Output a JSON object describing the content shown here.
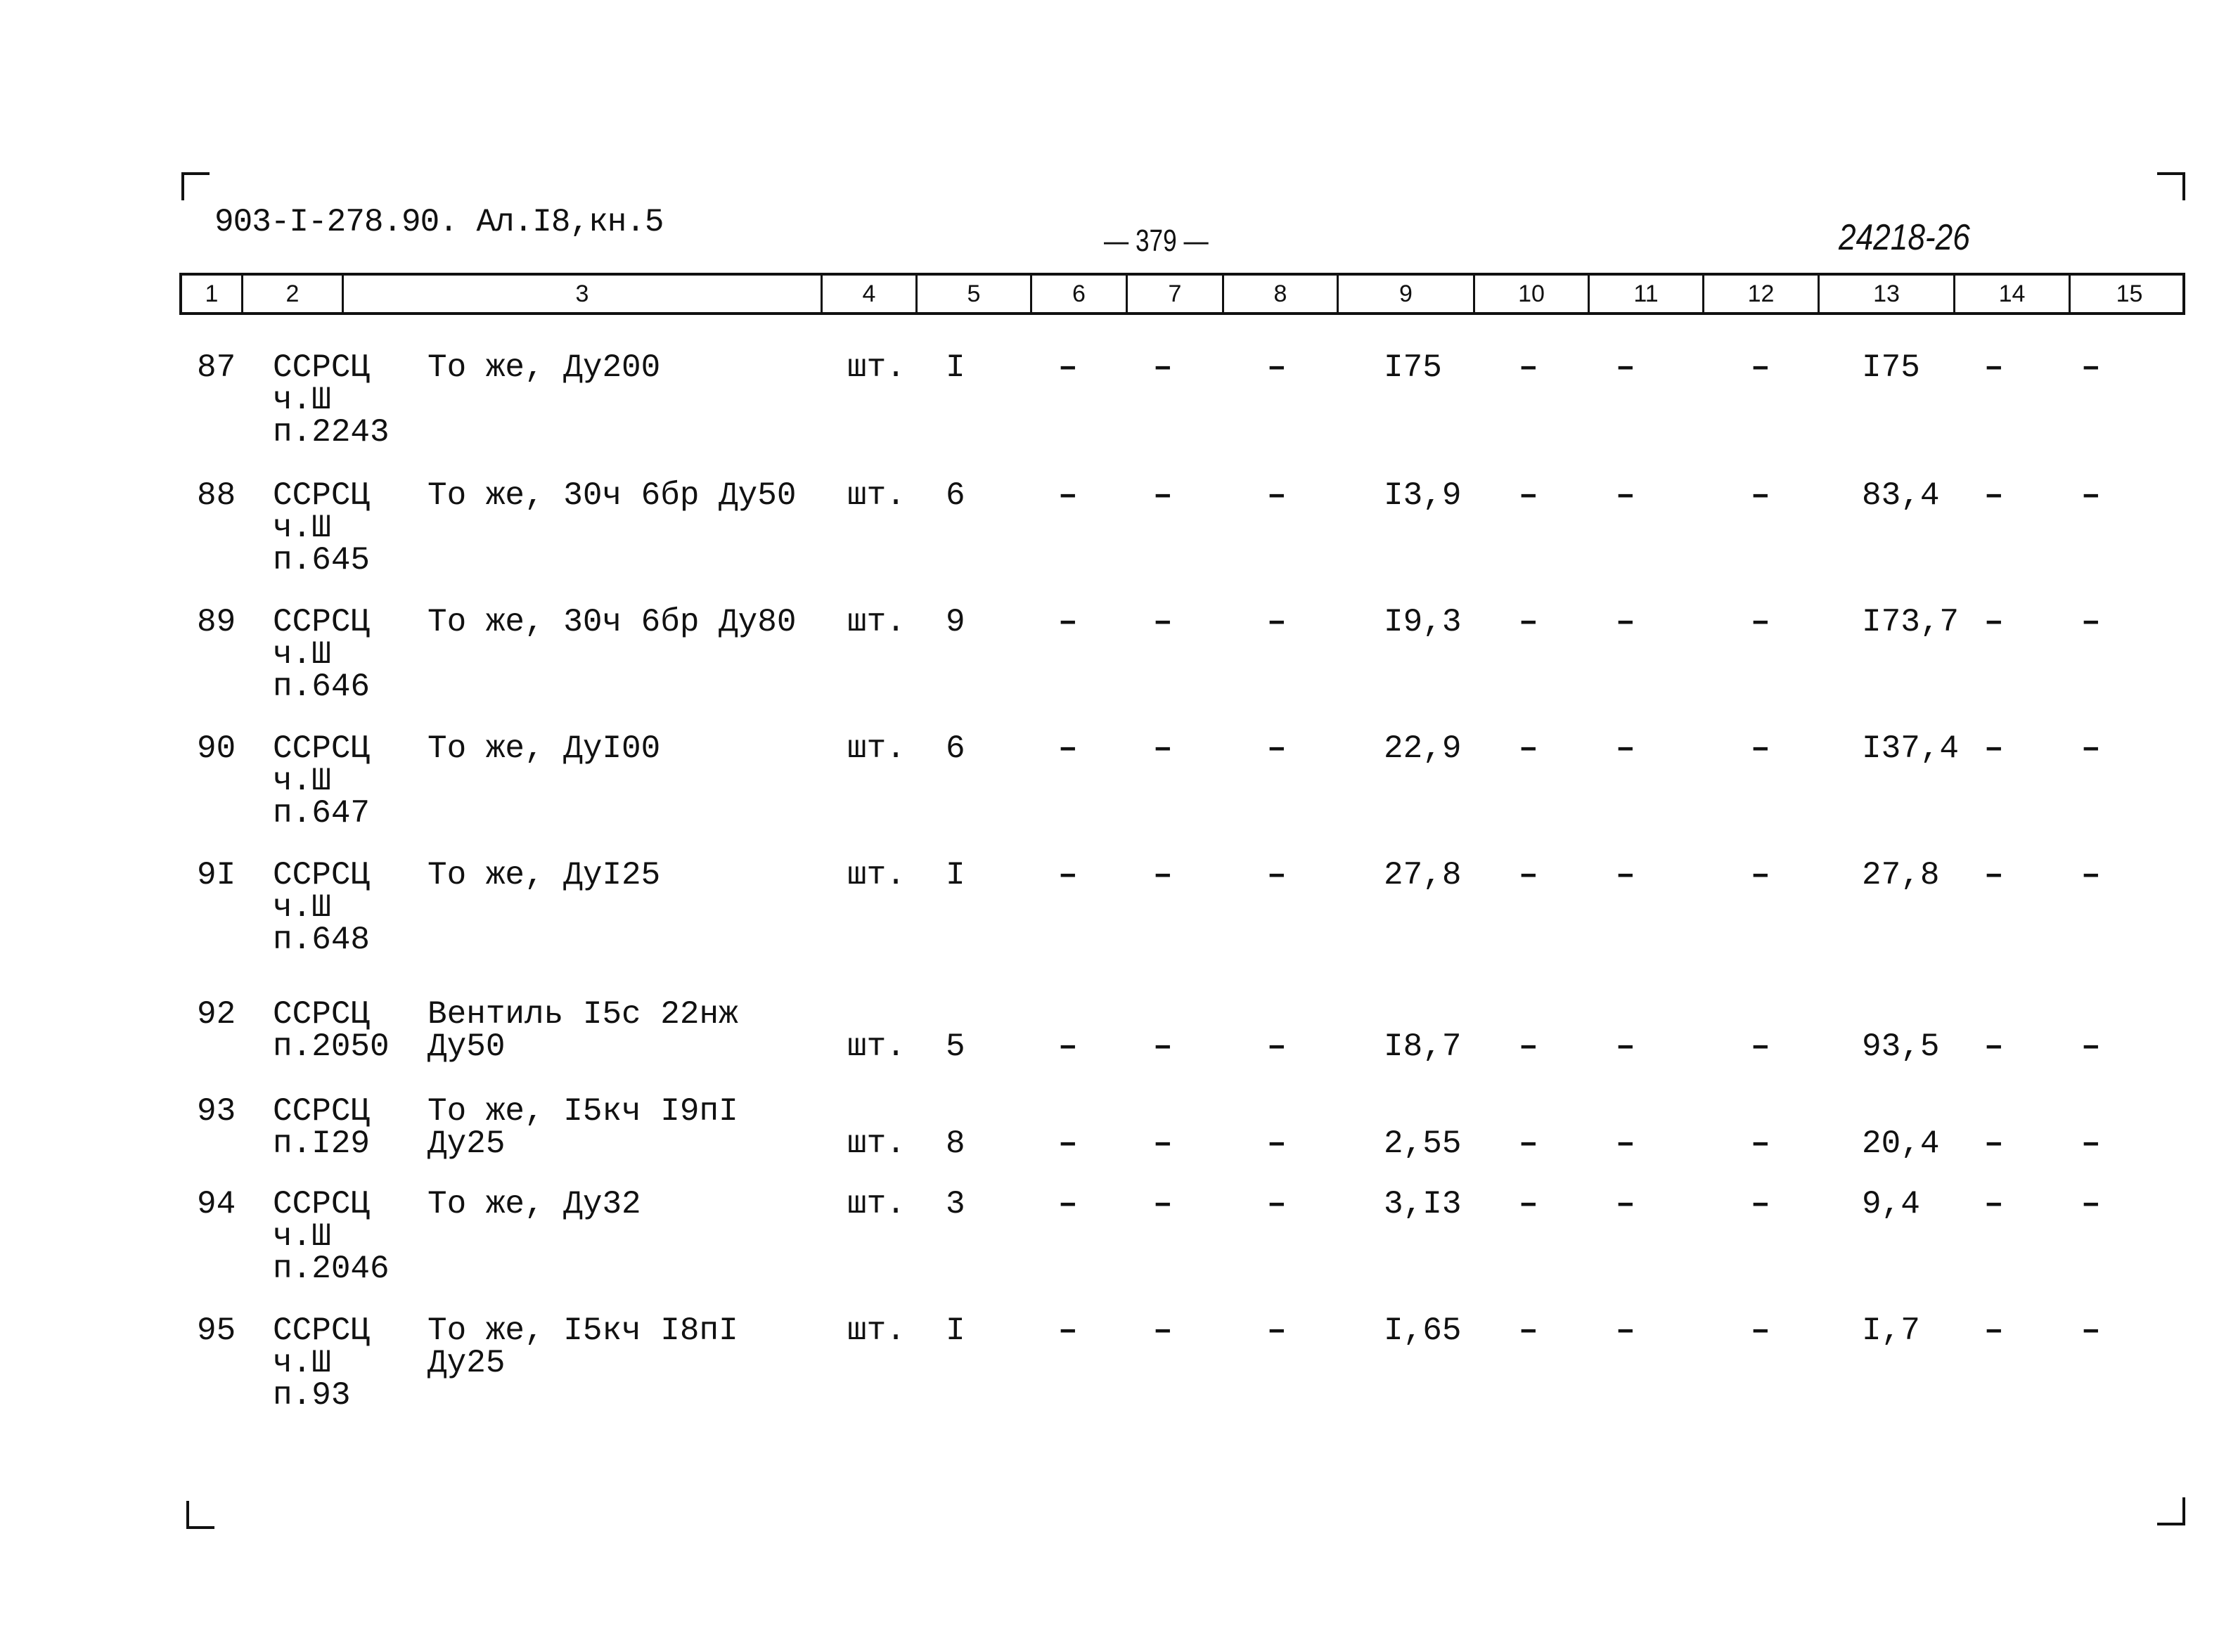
{
  "header": {
    "doc_code": "903-I-278.90. Ал.I8,кн.5",
    "page_number": "— 379 —",
    "archive_number": "24218-26"
  },
  "columns": [
    "1",
    "2",
    "3",
    "4",
    "5",
    "6",
    "7",
    "8",
    "9",
    "10",
    "11",
    "12",
    "13",
    "14",
    "15"
  ],
  "rows": [
    {
      "n": "87",
      "ref": [
        "ССРСЦ",
        "ч.Ш",
        "п.2243"
      ],
      "desc": [
        "То же, Ду200"
      ],
      "unit": "шт.",
      "qty": "I",
      "c6": "–",
      "c7": "–",
      "c8": "–",
      "c9": "I75",
      "c10": "–",
      "c11": "–",
      "c12": "–",
      "c13": "I75",
      "c14": "–",
      "c15": "–"
    },
    {
      "n": "88",
      "ref": [
        "ССРСЦ",
        "ч.Ш",
        "п.645"
      ],
      "desc": [
        "То же, 30ч 6бр Ду50"
      ],
      "unit": "шт.",
      "qty": "6",
      "c6": "–",
      "c7": "–",
      "c8": "–",
      "c9": "I3,9",
      "c10": "–",
      "c11": "–",
      "c12": "–",
      "c13": "83,4",
      "c14": "–",
      "c15": "–"
    },
    {
      "n": "89",
      "ref": [
        "ССРСЦ",
        "ч.Ш",
        "п.646"
      ],
      "desc": [
        "То же, 30ч 6бр Ду80"
      ],
      "unit": "шт.",
      "qty": "9",
      "c6": "–",
      "c7": "–",
      "c8": "–",
      "c9": "I9,3",
      "c10": "–",
      "c11": "–",
      "c12": "–",
      "c13": "I73,7",
      "c14": "–",
      "c15": "–"
    },
    {
      "n": "90",
      "ref": [
        "ССРСЦ",
        "ч.Ш",
        "п.647"
      ],
      "desc": [
        "То же, ДуI00"
      ],
      "unit": "шт.",
      "qty": "6",
      "c6": "–",
      "c7": "–",
      "c8": "–",
      "c9": "22,9",
      "c10": "–",
      "c11": "–",
      "c12": "–",
      "c13": "I37,4",
      "c14": "–",
      "c15": "–"
    },
    {
      "n": "9I",
      "ref": [
        "ССРСЦ",
        "ч.Ш",
        "п.648"
      ],
      "desc": [
        "То же, ДуI25"
      ],
      "unit": "шт.",
      "qty": "I",
      "c6": "–",
      "c7": "–",
      "c8": "–",
      "c9": "27,8",
      "c10": "–",
      "c11": "–",
      "c12": "–",
      "c13": "27,8",
      "c14": "–",
      "c15": "–"
    },
    {
      "n": "92",
      "ref": [
        "ССРСЦ",
        "п.2050"
      ],
      "desc": [
        "Вентиль I5с 22нж",
        "Ду50"
      ],
      "unit": "шт.",
      "qty": "5",
      "c6": "–",
      "c7": "–",
      "c8": "–",
      "c9": "I8,7",
      "c10": "–",
      "c11": "–",
      "c12": "–",
      "c13": "93,5",
      "c14": "–",
      "c15": "–"
    },
    {
      "n": "93",
      "ref": [
        "ССРСЦ",
        "п.I29"
      ],
      "desc": [
        "То же, I5кч I9пI",
        "Ду25"
      ],
      "unit": "шт.",
      "qty": "8",
      "c6": "–",
      "c7": "–",
      "c8": "–",
      "c9": "2,55",
      "c10": "–",
      "c11": "–",
      "c12": "–",
      "c13": "20,4",
      "c14": "–",
      "c15": "–"
    },
    {
      "n": "94",
      "ref": [
        "ССРСЦ",
        "ч.Ш",
        "п.2046"
      ],
      "desc": [
        "То же, Ду32"
      ],
      "unit": "шт.",
      "qty": "3",
      "c6": "–",
      "c7": "–",
      "c8": "–",
      "c9": "3,I3",
      "c10": "–",
      "c11": "–",
      "c12": "–",
      "c13": "9,4",
      "c14": "–",
      "c15": "–"
    },
    {
      "n": "95",
      "ref": [
        "ССРСЦ",
        "ч.Ш",
        "п.93"
      ],
      "desc": [
        "То же, I5кч I8пI",
        "Ду25"
      ],
      "unit": "шт.",
      "qty": "I",
      "c6": "–",
      "c7": "–",
      "c8": "–",
      "c9": "I,65",
      "c10": "–",
      "c11": "–",
      "c12": "–",
      "c13": "I,7",
      "c14": "–",
      "c15": "–"
    }
  ]
}
